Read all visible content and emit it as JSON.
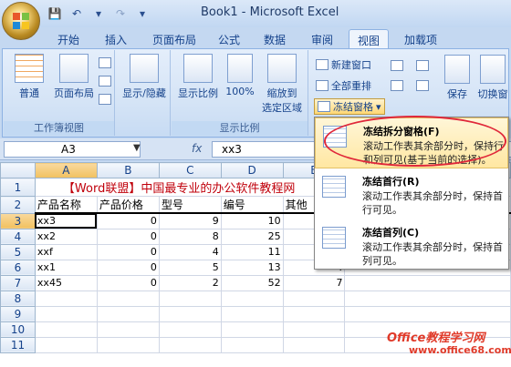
{
  "window": {
    "title": "Book1 - Microsoft Excel"
  },
  "tabs": [
    "开始",
    "插入",
    "页面布局",
    "公式",
    "数据",
    "审阅",
    "视图",
    "加载项"
  ],
  "active_tab": "视图",
  "ribbon": {
    "workbook_views": {
      "normal": "普通",
      "page_layout": "页面布局",
      "group_label": "工作簿视图"
    },
    "show_hide": {
      "label": "显示/隐藏"
    },
    "zoom": {
      "zoom": "显示比例",
      "hundred": "100%",
      "zoom_selection_1": "缩放到",
      "zoom_selection_2": "选定区域",
      "group_label": "显示比例"
    },
    "window": {
      "new_window": "新建窗口",
      "arrange_all": "全部重排",
      "freeze_panes": "冻结窗格",
      "save": "保存",
      "switch": "切换窗"
    }
  },
  "formula_bar": {
    "name_box": "A3",
    "fx": "fx",
    "content": "xx3"
  },
  "sheet": {
    "columns": [
      "A",
      "B",
      "C",
      "D",
      "E"
    ],
    "rows": [
      {
        "n": "1",
        "cells": [
          "【Word联盟】中国最专业的办公软件教程网"
        ]
      },
      {
        "n": "2",
        "cells": [
          "产品名称",
          "产品价格",
          "型号",
          "编号",
          "其他"
        ]
      },
      {
        "n": "3",
        "cells": [
          "xx3",
          "0",
          "9",
          "10",
          ""
        ]
      },
      {
        "n": "4",
        "cells": [
          "xx2",
          "0",
          "8",
          "25",
          ""
        ]
      },
      {
        "n": "5",
        "cells": [
          "xxf",
          "0",
          "4",
          "11",
          ""
        ]
      },
      {
        "n": "6",
        "cells": [
          "xx1",
          "0",
          "5",
          "13",
          "4"
        ]
      },
      {
        "n": "7",
        "cells": [
          "xx45",
          "0",
          "2",
          "52",
          "7"
        ]
      },
      {
        "n": "8",
        "cells": []
      },
      {
        "n": "9",
        "cells": []
      },
      {
        "n": "10",
        "cells": []
      },
      {
        "n": "11",
        "cells": []
      }
    ]
  },
  "freeze_menu": [
    {
      "title": "冻结拆分窗格(F)",
      "desc": "滚动工作表其余部分时，保持行和列可见(基于当前的选择)。"
    },
    {
      "title": "冻结首行(R)",
      "desc": "滚动工作表其余部分时，保持首行可见。"
    },
    {
      "title": "冻结首列(C)",
      "desc": "滚动工作表其余部分时，保持首列可见。"
    }
  ],
  "watermark": {
    "line1": "Office教程学习网",
    "line2": "www.office68.com"
  },
  "colors": {
    "title_red": "#c0000b",
    "menu_highlight_ring": "#e0283a"
  }
}
